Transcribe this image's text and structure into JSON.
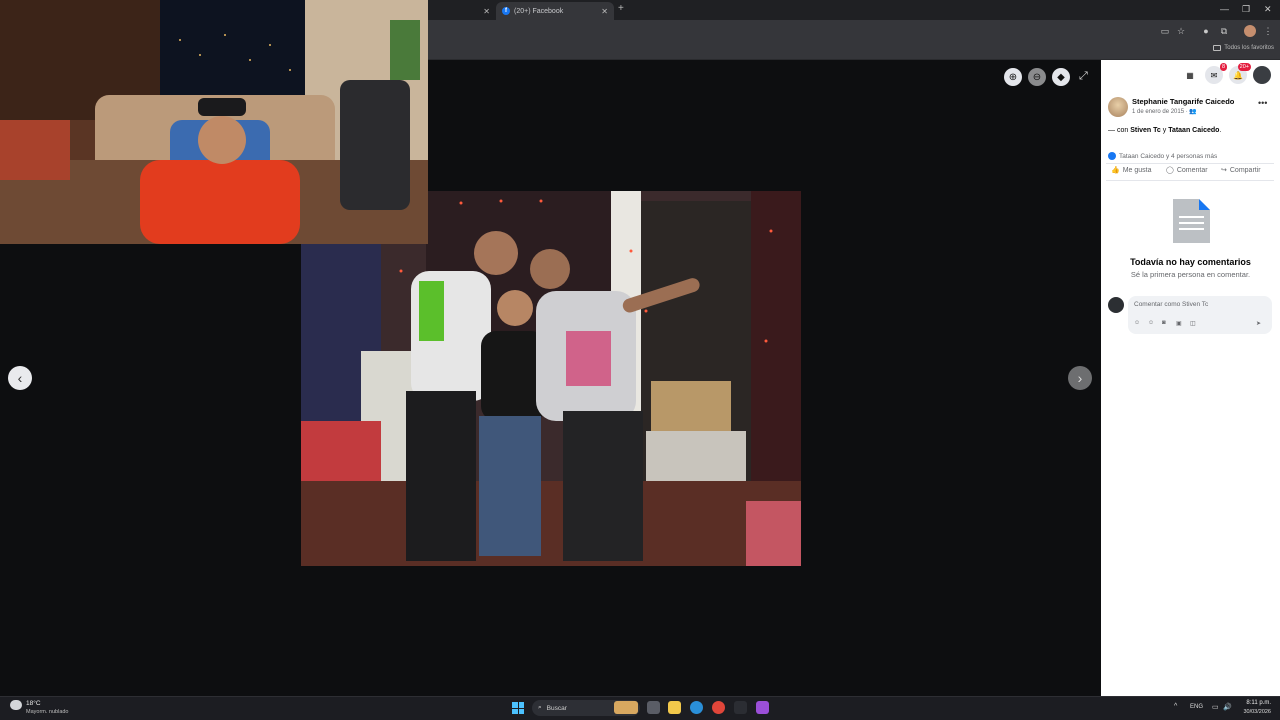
{
  "browser": {
    "active_tab_title": "(20+) Facebook",
    "bookmarks_all_label": "Todos los favoritos"
  },
  "viewer": {
    "photo_description_icon": "photo",
    "zoom_in_icon": "zoom-in-icon",
    "zoom_out_icon": "zoom-out-icon",
    "tag_icon": "tag-icon",
    "expand_icon": "expand-icon"
  },
  "topbar": {
    "messenger_badge": "8",
    "notifications_badge": "20+"
  },
  "post": {
    "author": "Stephanie Tangarife Caicedo",
    "date": "1 de enero de 2015",
    "tagged_prefix": "— con ",
    "tagged_person_1": "Stiven Tc",
    "tagged_and": " y ",
    "tagged_person_2": "Tataan Caicedo",
    "tagged_suffix": ".",
    "reactions_text": "Tataan Caicedo y 4 personas más",
    "actions": {
      "like": "Me gusta",
      "comment": "Comentar",
      "share": "Compartir"
    },
    "no_comments_title": "Todavía no hay comentarios",
    "no_comments_sub": "Sé la primera persona en comentar.",
    "comment_placeholder": "Comentar como Stiven Tc"
  },
  "taskbar": {
    "temperature": "18°C",
    "weather": "Mayorm. nublado",
    "search_label": "Buscar",
    "language": "ENG",
    "time": "8:11 p.m.",
    "date": "30/03/2026"
  },
  "colors": {
    "facebook_blue": "#1877f2",
    "badge_red": "#e41e3f",
    "taskbar_bg": "#1c1d22"
  }
}
